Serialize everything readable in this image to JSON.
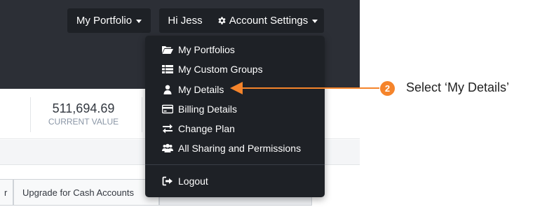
{
  "nav": {
    "portfolio_label": "My Portfolio",
    "greeting": "Hi Jess",
    "account_settings_label": "Account Settings"
  },
  "stats": {
    "current_value": "511,694.69",
    "current_value_label": "CURRENT VALUE"
  },
  "tabs": {
    "left_partial": "r",
    "upgrade_label": "Upgrade for Cash Accounts"
  },
  "dropdown": {
    "items": [
      {
        "label": "My Portfolios",
        "icon": "folder-open-icon"
      },
      {
        "label": "My Custom Groups",
        "icon": "list-icon"
      },
      {
        "label": "My Details",
        "icon": "user-icon"
      },
      {
        "label": "Billing Details",
        "icon": "credit-card-icon"
      },
      {
        "label": "Change Plan",
        "icon": "exchange-icon"
      },
      {
        "label": "All Sharing and Permissions",
        "icon": "users-icon"
      }
    ],
    "logout": {
      "label": "Logout",
      "icon": "sign-out-icon"
    }
  },
  "callout": {
    "step": "2",
    "text": "Select ‘My Details’",
    "color": "#f5842b"
  },
  "colors": {
    "topbar": "#2c2f36",
    "dropdown_bg": "#1e2126",
    "accent": "#f5842b"
  }
}
